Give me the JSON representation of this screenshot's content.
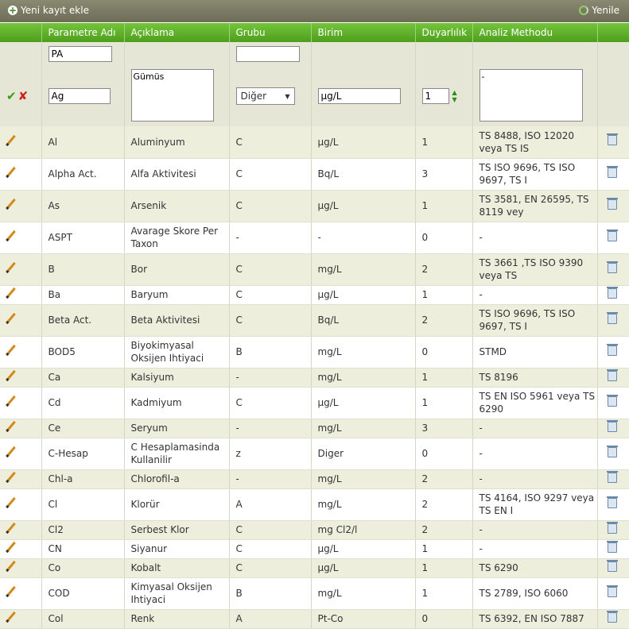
{
  "toolbar": {
    "add_label": "Yeni kayıt ekle",
    "refresh_label": "Yenile"
  },
  "columns": [
    "Parametre Adı",
    "Açıklama",
    "Grubu",
    "Birim",
    "Duyarlılık",
    "Analiz Methodu"
  ],
  "filters": {
    "parametre": "PA",
    "grubu": ""
  },
  "edit_row": {
    "parametre": "Ag",
    "aciklama": "Gümüs",
    "grubu": "Diğer",
    "birim": "µg/L",
    "duyarlilik": "1",
    "analiz": "-"
  },
  "rows": [
    {
      "param": "Al",
      "desc": "Aluminyum",
      "group": "C",
      "unit": "µg/L",
      "sens": "1",
      "method": "TS 8488, ISO 12020 veya TS IS"
    },
    {
      "param": "Alpha Act.",
      "desc": "Alfa Aktivitesi",
      "group": "C",
      "unit": "Bq/L",
      "sens": "3",
      "method": "TS ISO 9696, TS ISO 9697, TS I"
    },
    {
      "param": "As",
      "desc": "Arsenik",
      "group": "C",
      "unit": "µg/L",
      "sens": "1",
      "method": "TS 3581, EN 26595, TS 8119 vey"
    },
    {
      "param": "ASPT",
      "desc": "Avarage Skore Per Taxon",
      "group": "-",
      "unit": "-",
      "sens": "0",
      "method": "-"
    },
    {
      "param": "B",
      "desc": "Bor",
      "group": "C",
      "unit": "mg/L",
      "sens": "2",
      "method": "TS 3661 ,TS ISO 9390 veya TS"
    },
    {
      "param": "Ba",
      "desc": "Baryum",
      "group": "C",
      "unit": "µg/L",
      "sens": "1",
      "method": "-"
    },
    {
      "param": "Beta Act.",
      "desc": "Beta Aktivitesi",
      "group": "C",
      "unit": "Bq/L",
      "sens": "2",
      "method": "TS ISO 9696, TS ISO 9697, TS I"
    },
    {
      "param": "BOD5",
      "desc": "Biyokimyasal Oksijen Ihtiyaci",
      "group": "B",
      "unit": "mg/L",
      "sens": "0",
      "method": "STMD"
    },
    {
      "param": "Ca",
      "desc": "Kalsiyum",
      "group": "-",
      "unit": "mg/L",
      "sens": "1",
      "method": "TS 8196"
    },
    {
      "param": "Cd",
      "desc": "Kadmiyum",
      "group": "C",
      "unit": "µg/L",
      "sens": "1",
      "method": "TS EN ISO 5961 veya TS 6290"
    },
    {
      "param": "Ce",
      "desc": "Seryum",
      "group": "-",
      "unit": "mg/L",
      "sens": "3",
      "method": "-"
    },
    {
      "param": "C-Hesap",
      "desc": "C Hesaplamasinda Kullanilir",
      "group": "z",
      "unit": "Diger",
      "sens": "0",
      "method": "-"
    },
    {
      "param": "Chl-a",
      "desc": "Chlorofil-a",
      "group": "-",
      "unit": "mg/L",
      "sens": "2",
      "method": "-"
    },
    {
      "param": "Cl",
      "desc": "Klorür",
      "group": "A",
      "unit": "mg/L",
      "sens": "2",
      "method": "TS 4164, ISO 9297 veya TS EN I"
    },
    {
      "param": "Cl2",
      "desc": "Serbest Klor",
      "group": "C",
      "unit": "mg Cl2/l",
      "sens": "2",
      "method": "-"
    },
    {
      "param": "CN",
      "desc": "Siyanur",
      "group": "C",
      "unit": "µg/L",
      "sens": "1",
      "method": "-"
    },
    {
      "param": "Co",
      "desc": "Kobalt",
      "group": "C",
      "unit": "µg/L",
      "sens": "1",
      "method": "TS 6290"
    },
    {
      "param": "COD",
      "desc": "Kimyasal Oksijen Ihtiyaci",
      "group": "B",
      "unit": "mg/L",
      "sens": "1",
      "method": "TS 2789, ISO 6060"
    },
    {
      "param": "Col",
      "desc": "Renk",
      "group": "A",
      "unit": "Pt-Co",
      "sens": "0",
      "method": "TS 6392, EN ISO 7887"
    }
  ]
}
